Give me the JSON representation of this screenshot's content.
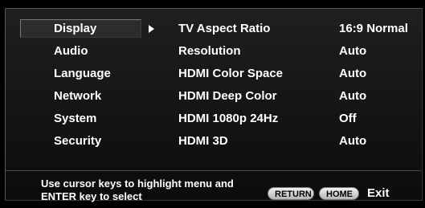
{
  "menu": {
    "categories": [
      {
        "label": "Display",
        "selected": true
      },
      {
        "label": "Audio",
        "selected": false
      },
      {
        "label": "Language",
        "selected": false
      },
      {
        "label": "Network",
        "selected": false
      },
      {
        "label": "System",
        "selected": false
      },
      {
        "label": "Security",
        "selected": false
      }
    ],
    "settings": [
      {
        "label": "TV Aspect Ratio",
        "value": "16:9 Normal"
      },
      {
        "label": "Resolution",
        "value": "Auto"
      },
      {
        "label": "HDMI Color Space",
        "value": "Auto"
      },
      {
        "label": "HDMI Deep Color",
        "value": "Auto"
      },
      {
        "label": "HDMI 1080p 24Hz",
        "value": "Off"
      },
      {
        "label": "HDMI 3D",
        "value": "Auto"
      }
    ]
  },
  "footer": {
    "hint_line1": "Use cursor keys to highlight menu and",
    "hint_line2": "ENTER key to select",
    "return_label": "RETURN",
    "home_label": "HOME",
    "exit_label": "Exit"
  },
  "colors": {
    "background": "#000000",
    "panel": "#161616",
    "text": "#ffffff",
    "selection": "#2c2c2c",
    "button": "#d8d8d8"
  }
}
